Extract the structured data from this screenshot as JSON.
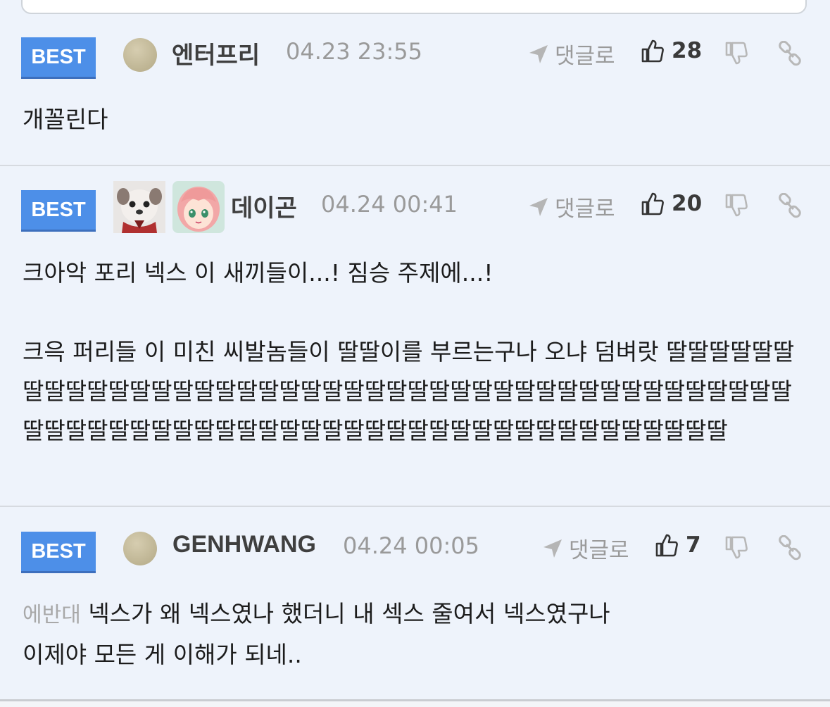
{
  "comments": [
    {
      "badge": "BEST",
      "username": "엔터프리",
      "timestamp": "04.23 23:55",
      "reply_label": "댓글로",
      "likes": "28",
      "body": "개꼴린다"
    },
    {
      "badge": "BEST",
      "username": "데이곤",
      "timestamp": "04.24 00:41",
      "reply_label": "댓글로",
      "likes": "20",
      "body": "크아악 포리 넥스 이 새끼들이...! 짐승 주제에...!\n\n크윽 퍼리들 이 미친 씨발놈들이 딸딸이를 부르는구나 오냐 덤벼랏 딸딸딸딸딸딸딸딸딸딸딸딸딸딸딸딸딸딸딸딸딸딸딸딸딸딸딸딸딸딸딸딸딸딸딸딸딸딸딸딸딸딸딸딸딸딸딸딸딸딸딸딸딸딸딸딸딸딸딸딸딸딸딸딸딸딸딸딸딸딸딸딸딸딸딸"
    },
    {
      "badge": "BEST",
      "username": "GENHWANG",
      "timestamp": "04.24 00:05",
      "reply_label": "댓글로",
      "likes": "7",
      "reply_to": "에반대",
      "body": "넥스가 왜 넥스였나 했더니 내 섹스 줄여서 넥스였구나\n이제야 모든 게 이해가 되네.."
    }
  ]
}
